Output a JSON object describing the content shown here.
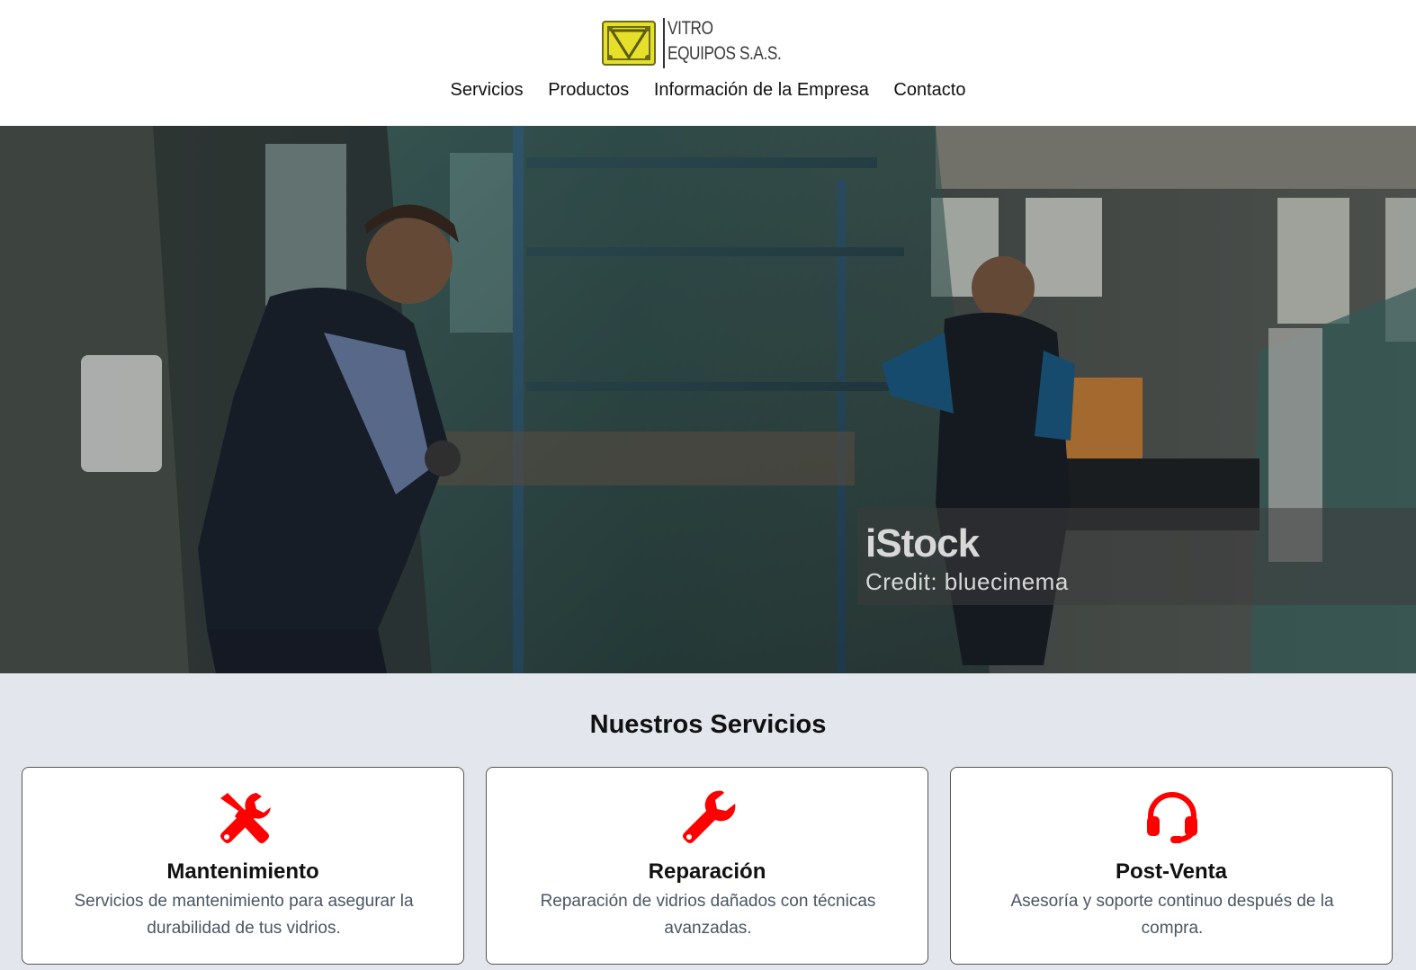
{
  "header": {
    "logo": {
      "line1": "VITRO",
      "line2": "EQUIPOS S.A.S.",
      "mark_color": "#c9c21a"
    },
    "nav": [
      "Servicios",
      "Productos",
      "Información de la Empresa",
      "Contacto"
    ]
  },
  "hero": {
    "watermark_brand": "iStock",
    "watermark_credit": "Credit: bluecinema"
  },
  "services": {
    "title": "Nuestros Servicios",
    "accent_color": "#ff0000",
    "cards": [
      {
        "icon": "tools-icon",
        "title": "Mantenimiento",
        "text": "Servicios de mantenimiento para asegurar la durabilidad de tus vidrios."
      },
      {
        "icon": "wrench-icon",
        "title": "Reparación",
        "text": "Reparación de vidrios dañados con técnicas avanzadas."
      },
      {
        "icon": "headset-icon",
        "title": "Post-Venta",
        "text": "Asesoría y soporte continuo después de la compra."
      }
    ]
  }
}
